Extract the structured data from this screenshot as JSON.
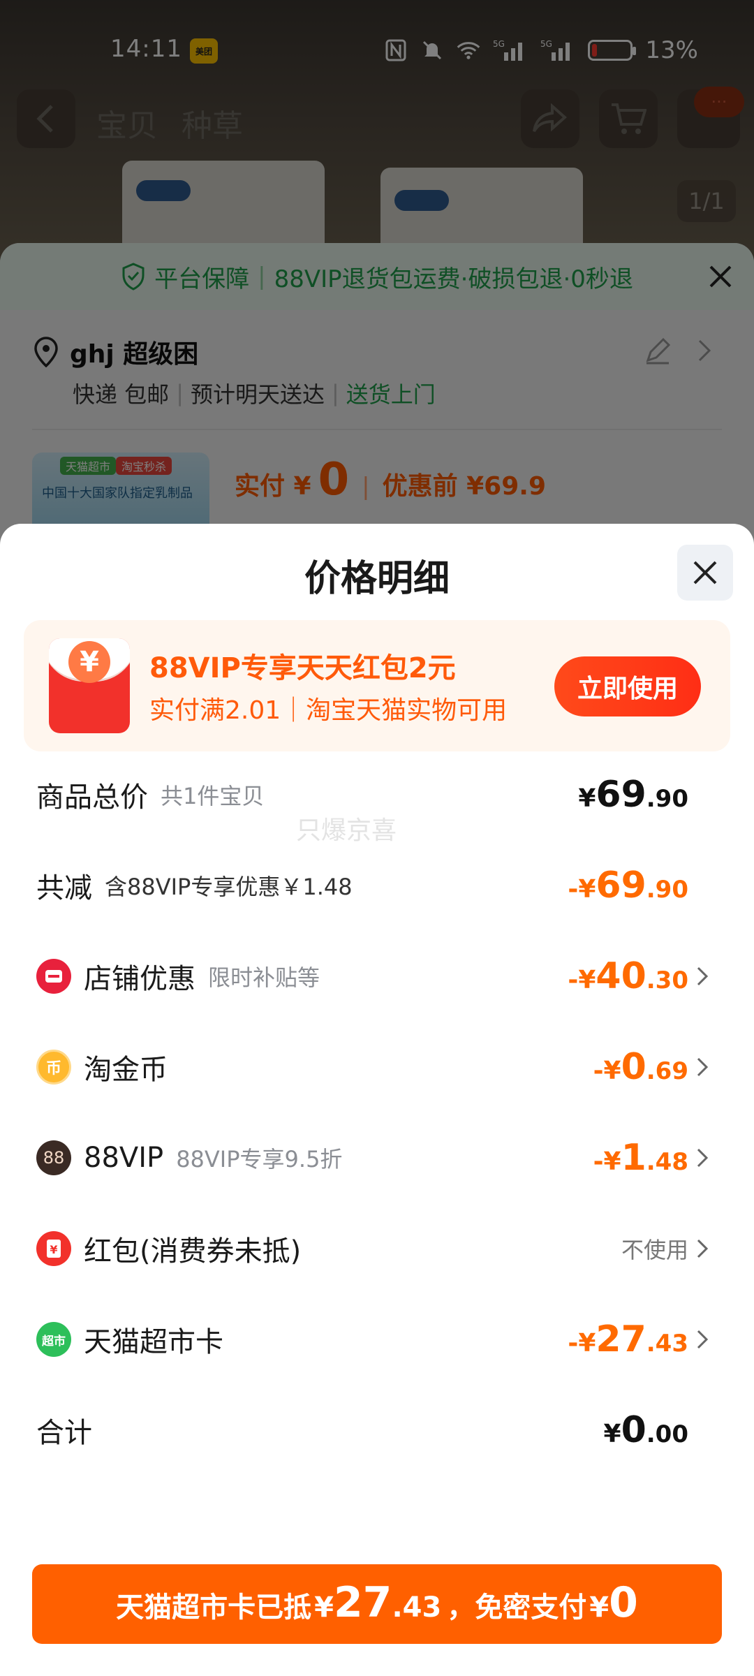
{
  "status_bar": {
    "time": "14:11",
    "app_badge": "美团",
    "network_1": "5G",
    "network_2": "5G",
    "battery_percent": "13%",
    "battery_level": 0.13
  },
  "nav": {
    "tabs": [
      "宝贝",
      "种草"
    ],
    "cart_badge": "···",
    "image_counter": "1/1"
  },
  "order_sheet": {
    "guarantee_label": "平台保障",
    "guarantee_text": "88VIP退货包运费·破损包退·0秒退",
    "address_name": "ghj 超级困",
    "delivery_method": "快递 包邮",
    "delivery_eta": "预计明天送达",
    "delivery_door": "送货上门",
    "thumb_tag_1": "天猫超市",
    "thumb_tag_2": "淘宝秒杀",
    "thumb_text": "中国十大国家队指定乳制品",
    "price_paid_label": "实付 ¥",
    "price_paid_value": "0",
    "price_before": "优惠前 ¥69.9"
  },
  "modal": {
    "title": "价格明细",
    "promo": {
      "title": "88VIP专享天天红包2元",
      "subtitle": "实付满2.01｜淘宝天猫实物可用",
      "button": "立即使用",
      "coin_symbol": "¥"
    },
    "rows": {
      "total": {
        "label": "商品总价",
        "sub": "共1件宝贝",
        "cur": "¥",
        "int": "69",
        "dec": ".90"
      },
      "reduce": {
        "label": "共减",
        "sub": "含88VIP专享优惠￥1.48",
        "cur": "-¥",
        "int": "69",
        "dec": ".90"
      },
      "shop": {
        "label": "店铺优惠",
        "sub": "限时补贴等",
        "cur": "-¥",
        "int": "40",
        "dec": ".30"
      },
      "coin": {
        "label": "淘金币",
        "icon_text": "币",
        "cur": "-¥",
        "int": "0",
        "dec": ".69"
      },
      "vip": {
        "label": "88VIP",
        "sub": "88VIP专享9.5折",
        "icon_text": "88",
        "cur": "-¥",
        "int": "1",
        "dec": ".48"
      },
      "redpacket": {
        "label": "红包(消费券未抵)",
        "value": "不使用"
      },
      "tmall_card": {
        "label": "天猫超市卡",
        "icon_text": "超市",
        "cur": "-¥",
        "int": "27",
        "dec": ".43"
      },
      "sum": {
        "label": "合计",
        "cur": "¥",
        "int": "0",
        "dec": ".00"
      }
    },
    "watermark": "只爆京喜",
    "pay_button": {
      "prefix": "天猫超市卡已抵",
      "cur": "¥",
      "int": "27",
      "dec": ".43",
      "middle": "，免密支付",
      "cur2": "¥",
      "int2": "0"
    }
  },
  "colors": {
    "accent_orange": "#ff6000",
    "promo_red": "#ff5a0a",
    "green": "#1f9e4a"
  }
}
